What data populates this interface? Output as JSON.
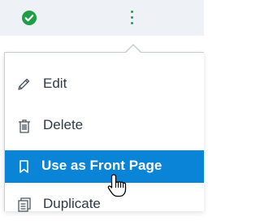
{
  "header": {
    "status_icon": "check-circle-icon",
    "menu_icon": "kebab-menu-icon",
    "accent_green": "#16a34a"
  },
  "menu": {
    "items": [
      {
        "label": "Edit",
        "icon": "pencil-icon"
      },
      {
        "label": "Delete",
        "icon": "trash-icon"
      },
      {
        "label": "Use as Front Page",
        "icon": "bookmark-icon",
        "selected": true
      },
      {
        "label": "Duplicate",
        "icon": "duplicate-icon"
      }
    ],
    "selected_color": "#0a84d6"
  },
  "cursor": "hand-pointer-icon"
}
